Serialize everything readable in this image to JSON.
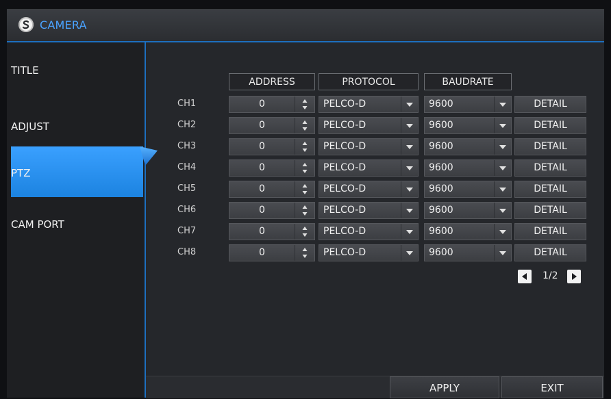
{
  "window": {
    "title": "CAMERA",
    "icon": "camera-logo-icon"
  },
  "sidebar": {
    "items": [
      {
        "label": "TITLE",
        "active": false
      },
      {
        "label": "ADJUST",
        "active": false
      },
      {
        "label": "PTZ",
        "active": true
      },
      {
        "label": "CAM PORT",
        "active": false
      }
    ]
  },
  "table": {
    "headers": {
      "address": "ADDRESS",
      "protocol": "PROTOCOL",
      "baudrate": "BAUDRATE"
    },
    "rows": [
      {
        "channel": "CH1",
        "address": "0",
        "protocol": "PELCO-D",
        "baudrate": "9600",
        "detail": "DETAIL"
      },
      {
        "channel": "CH2",
        "address": "0",
        "protocol": "PELCO-D",
        "baudrate": "9600",
        "detail": "DETAIL"
      },
      {
        "channel": "CH3",
        "address": "0",
        "protocol": "PELCO-D",
        "baudrate": "9600",
        "detail": "DETAIL"
      },
      {
        "channel": "CH4",
        "address": "0",
        "protocol": "PELCO-D",
        "baudrate": "9600",
        "detail": "DETAIL"
      },
      {
        "channel": "CH5",
        "address": "0",
        "protocol": "PELCO-D",
        "baudrate": "9600",
        "detail": "DETAIL"
      },
      {
        "channel": "CH6",
        "address": "0",
        "protocol": "PELCO-D",
        "baudrate": "9600",
        "detail": "DETAIL"
      },
      {
        "channel": "CH7",
        "address": "0",
        "protocol": "PELCO-D",
        "baudrate": "9600",
        "detail": "DETAIL"
      },
      {
        "channel": "CH8",
        "address": "0",
        "protocol": "PELCO-D",
        "baudrate": "9600",
        "detail": "DETAIL"
      }
    ]
  },
  "pager": {
    "text": "1/2"
  },
  "footer": {
    "apply_label": "APPLY",
    "exit_label": "EXIT"
  },
  "colors": {
    "accent": "#1d6fbf",
    "active_item": "#2a90ee",
    "title_text": "#4aa3ff"
  }
}
